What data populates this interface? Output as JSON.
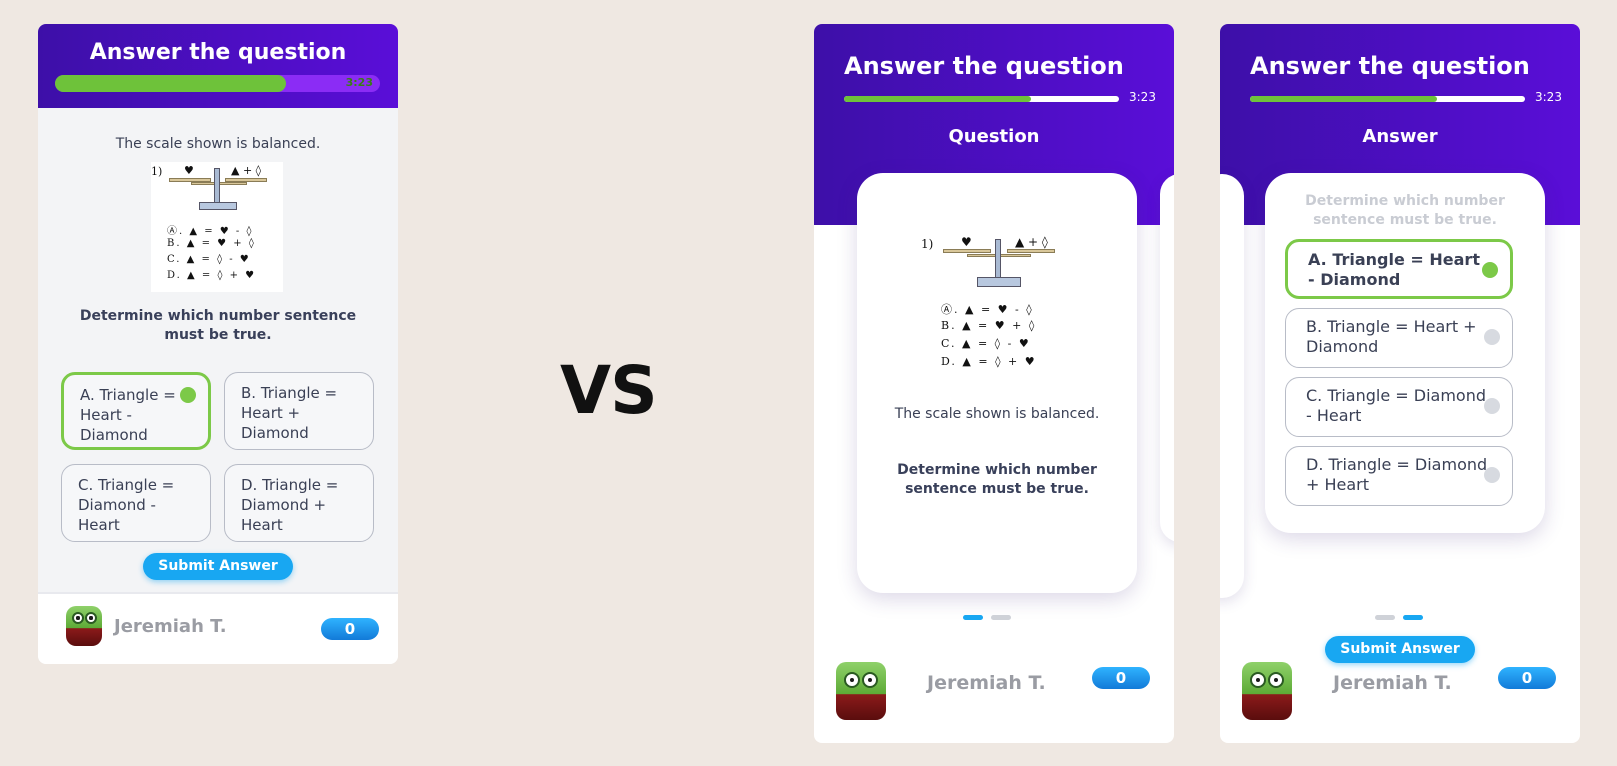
{
  "vs_label": "VS",
  "left": {
    "title": "Answer the question",
    "timer": "3:23",
    "progress_fraction": 0.71,
    "prompt": "The scale shown is balanced.",
    "question": "Determine which number sentence must be true.",
    "options": [
      {
        "label": "A. Triangle = Heart - Diamond",
        "selected": true
      },
      {
        "label": "B. Triangle = Heart + Diamond",
        "selected": false
      },
      {
        "label": "C. Triangle = Diamond - Heart",
        "selected": false
      },
      {
        "label": "D. Triangle = Diamond + Heart",
        "selected": false
      }
    ],
    "submit_label": "Submit Answer",
    "user_name": "Jeremiah T.",
    "score": "0"
  },
  "scale_image": {
    "number": "1)",
    "left_pan": "♥",
    "right_pan": "▲ + ◊",
    "rows": [
      "Ⓐ.  ▲  =  ♥  -  ◊",
      "B.  ▲  =  ♥  +  ◊",
      "C.  ▲  =  ◊  -  ♥",
      "D.  ▲  =  ◊  +  ♥"
    ]
  },
  "mid": {
    "title": "Answer the question",
    "timer": "3:23",
    "progress_fraction": 0.68,
    "section": "Question",
    "prompt": "The scale shown is balanced.",
    "question": "Determine which number sentence must be true.",
    "user_name": "Jeremiah T.",
    "score": "0"
  },
  "right": {
    "title": "Answer the question",
    "timer": "3:23",
    "progress_fraction": 0.68,
    "section": "Answer",
    "question_faded": "Determine which number sentence must be true.",
    "options": [
      {
        "label": "A. Triangle = Heart - Diamond",
        "selected": true
      },
      {
        "label": "B. Triangle = Heart + Diamond",
        "selected": false
      },
      {
        "label": "C. Triangle = Diamond - Heart",
        "selected": false
      },
      {
        "label": "D. Triangle = Diamond + Heart",
        "selected": false
      }
    ],
    "submit_label": "Submit Answer",
    "user_name": "Jeremiah T.",
    "score": "0"
  },
  "colors": {
    "header": "#4a0fc4",
    "accent": "#18a7f2",
    "selected": "#7cc948",
    "background": "#efe8e2"
  }
}
